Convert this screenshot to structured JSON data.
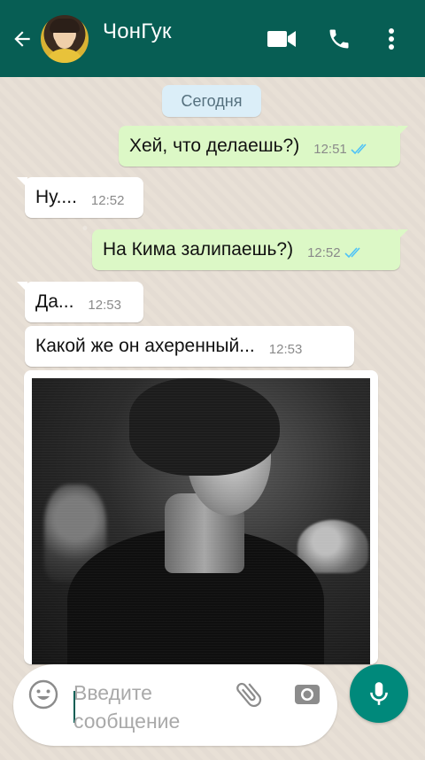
{
  "header": {
    "contact_name": "ЧонГук",
    "back_icon": "arrow-left-icon",
    "video_icon": "video-camera-icon",
    "call_icon": "phone-icon",
    "menu_icon": "more-vert-icon",
    "color": "#075e54"
  },
  "date_chip": "Сегодня",
  "messages": [
    {
      "direction": "out",
      "text": "Хей, что делаешь?)",
      "time": "12:51",
      "status": "read"
    },
    {
      "direction": "in",
      "text": "Ну....",
      "time": "12:52"
    },
    {
      "direction": "out",
      "text": "На Кима залипаешь?)",
      "time": "12:52",
      "status": "read"
    },
    {
      "direction": "in",
      "text": "Да...",
      "time": "12:53"
    },
    {
      "direction": "in",
      "text": "Какой же он ахеренный...",
      "time": "12:53"
    },
    {
      "direction": "in",
      "type": "image",
      "image": "black-and-white-photo"
    }
  ],
  "composer": {
    "placeholder": "Введите сообщение",
    "emoji_icon": "emoji-icon",
    "attach_icon": "paperclip-icon",
    "camera_icon": "camera-icon",
    "mic_icon": "microphone-icon"
  },
  "colors": {
    "outgoing_bubble": "#dcf8c6",
    "incoming_bubble": "#ffffff",
    "read_ticks": "#4fc3f7",
    "mic_button": "#00897b"
  }
}
